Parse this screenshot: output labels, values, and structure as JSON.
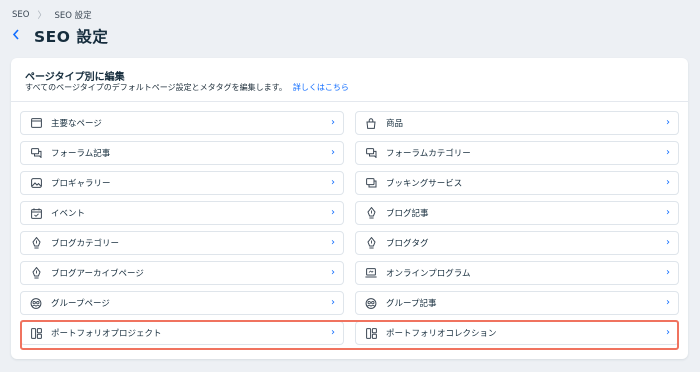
{
  "breadcrumb": {
    "items": [
      "SEO",
      "SEO 設定"
    ],
    "separator": "〉"
  },
  "header": {
    "title": "SEO 設定"
  },
  "card": {
    "title": "ページタイプ別に編集",
    "description": "すべてのページタイプのデフォルトページ設定とメタタグを編集します。",
    "link_label": "詳しくはこちら"
  },
  "items": [
    {
      "label": "主要なページ",
      "icon": "page-icon"
    },
    {
      "label": "商品",
      "icon": "bag-icon"
    },
    {
      "label": "フォーラム記事",
      "icon": "forum-icon"
    },
    {
      "label": "フォーラムカテゴリー",
      "icon": "forum-icon"
    },
    {
      "label": "プロギャラリー",
      "icon": "gallery-icon"
    },
    {
      "label": "ブッキングサービス",
      "icon": "booking-icon"
    },
    {
      "label": "イベント",
      "icon": "calendar-icon"
    },
    {
      "label": "ブログ記事",
      "icon": "pen-icon"
    },
    {
      "label": "ブログカテゴリー",
      "icon": "pen-icon"
    },
    {
      "label": "ブログタグ",
      "icon": "pen-icon"
    },
    {
      "label": "ブログアーカイブページ",
      "icon": "pen-icon"
    },
    {
      "label": "オンラインプログラム",
      "icon": "laptop-icon"
    },
    {
      "label": "グループページ",
      "icon": "group-icon"
    },
    {
      "label": "グループ記事",
      "icon": "group-icon"
    },
    {
      "label": "ポートフォリオプロジェクト",
      "icon": "portfolio-icon"
    },
    {
      "label": "ポートフォリオコレクション",
      "icon": "portfolio-icon"
    }
  ],
  "colors": {
    "accent": "#116dff",
    "highlight": "#f0735f",
    "background": "#edf0f4"
  }
}
